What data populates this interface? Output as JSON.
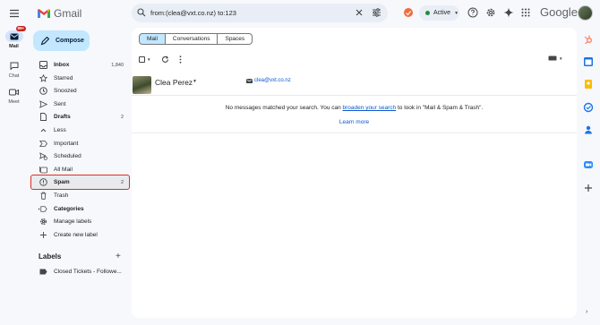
{
  "header": {
    "app_name": "Gmail",
    "search_value": "from:(clea@vxt.co.nz) to:123",
    "status_label": "Active",
    "account_label": "Google"
  },
  "rail": {
    "items": [
      {
        "label": "Mail",
        "badge": "99+"
      },
      {
        "label": "Chat"
      },
      {
        "label": "Meet"
      }
    ]
  },
  "compose_label": "Compose",
  "nav": [
    {
      "label": "Inbox",
      "count": "1,840",
      "icon": "inbox-icon",
      "bold": true
    },
    {
      "label": "Starred",
      "count": "",
      "icon": "star-icon"
    },
    {
      "label": "Snoozed",
      "count": "",
      "icon": "clock-icon"
    },
    {
      "label": "Sent",
      "count": "",
      "icon": "send-icon"
    },
    {
      "label": "Drafts",
      "count": "2",
      "icon": "draft-icon",
      "bold": true
    },
    {
      "label": "Less",
      "count": "",
      "icon": "chevron-up-icon"
    },
    {
      "label": "Important",
      "count": "",
      "icon": "important-icon"
    },
    {
      "label": "Scheduled",
      "count": "",
      "icon": "scheduled-icon"
    },
    {
      "label": "All Mail",
      "count": "",
      "icon": "all-mail-icon"
    },
    {
      "label": "Spam",
      "count": "2",
      "icon": "spam-icon",
      "bold": true,
      "highlighted": true
    },
    {
      "label": "Trash",
      "count": "",
      "icon": "trash-icon"
    },
    {
      "label": "Categories",
      "count": "",
      "icon": "label-icon",
      "bold": true
    },
    {
      "label": "Manage labels",
      "count": "",
      "icon": "gear-icon"
    },
    {
      "label": "Create new label",
      "count": "",
      "icon": "plus-icon"
    }
  ],
  "labels": {
    "heading": "Labels",
    "items": [
      {
        "label": "Closed Tickets - Followe..."
      }
    ]
  },
  "main": {
    "chips": [
      "Mail",
      "Conversations",
      "Spaces"
    ],
    "contact": {
      "name": "Clea Perez",
      "email": "clea@vxt.co.nz"
    },
    "empty_pre": "No messages matched your search. You can ",
    "empty_link": "broaden your search",
    "empty_post": " to look in \"Mail & Spam & Trash\".",
    "learn_more": "Learn more"
  },
  "colors": {
    "accent": "#0b57d0",
    "compose_bg": "#c2e7ff",
    "highlight_border": "#d93025",
    "active_dot": "#1e8e3e"
  }
}
